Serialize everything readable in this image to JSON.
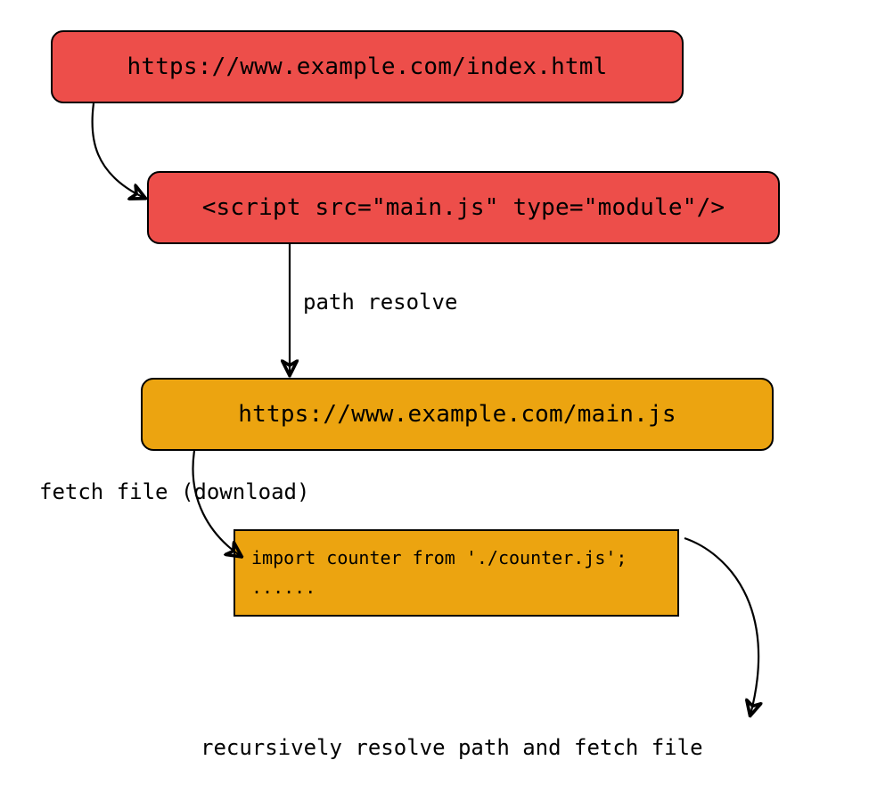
{
  "boxes": {
    "index": "https://www.example.com/index.html",
    "script": "<script src=\"main.js\" type=\"module\"/>",
    "mainjs": "https://www.example.com/main.js"
  },
  "code": {
    "line1": "import counter from './counter.js';",
    "line2": "......"
  },
  "labels": {
    "path_resolve": "path resolve",
    "fetch_file": "fetch file (download)",
    "recursive": "recursively resolve path and fetch file"
  },
  "colors": {
    "red": "#ed4e4a",
    "orange": "#eca410"
  }
}
